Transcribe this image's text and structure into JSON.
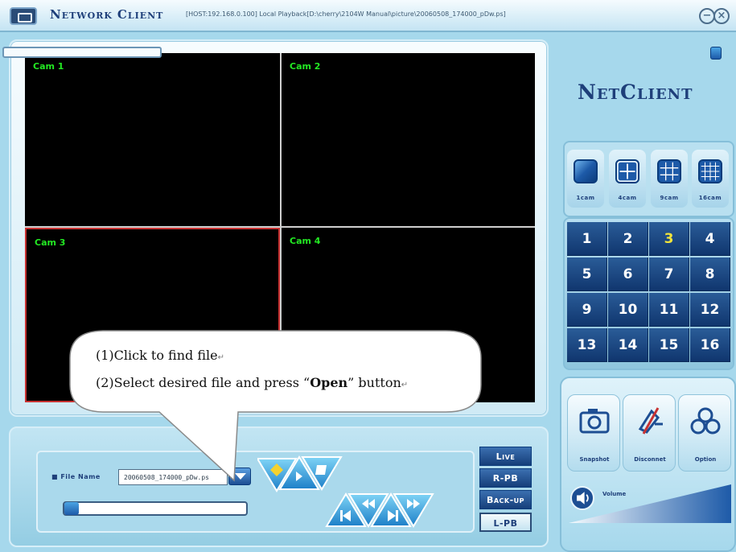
{
  "window": {
    "title_part1": "Network",
    "title_part2": "Client",
    "host_info": "[HOST:192.168.0.100] Local Playback[D:\\cherry\\2104W Manual\\picture\\20060508_174000_pDw.ps]",
    "minimize_label": "−",
    "close_label": "×"
  },
  "brand": {
    "part1": "Net",
    "part2": "Client"
  },
  "cameras": [
    {
      "label": "Cam  1"
    },
    {
      "label": "Cam  2"
    },
    {
      "label": "Cam  3"
    },
    {
      "label": "Cam  4"
    }
  ],
  "split_modes": [
    {
      "label": "1cam",
      "icon": "single-view-icon"
    },
    {
      "label": "4cam",
      "icon": "quad-view-icon"
    },
    {
      "label": "9cam",
      "icon": "nine-view-icon"
    },
    {
      "label": "16cam",
      "icon": "sixteen-view-icon"
    }
  ],
  "channels": [
    "1",
    "2",
    "3",
    "4",
    "5",
    "6",
    "7",
    "8",
    "9",
    "10",
    "11",
    "12",
    "13",
    "14",
    "15",
    "16"
  ],
  "active_channel": "3",
  "tools": {
    "snapshot": "Snapshot",
    "disconnect": "Disconnet",
    "option": "Option",
    "volume": "Volume"
  },
  "playback": {
    "file_name_label": "File Name",
    "file_name_value": "20060508_174000_pDw.ps",
    "progress": 0.0
  },
  "modes": {
    "live": "Live",
    "rpb": "R-PB",
    "backup": "Back-up",
    "lpb": "L-PB"
  },
  "volume_level": 0.95,
  "callout": {
    "line1": "(1)Click to find file",
    "line2_prefix": "(2)Select desired file and press “",
    "line2_bold": "Open",
    "line2_suffix": "” button",
    "return_mark": "↵"
  },
  "colors": {
    "cam_label": "#23e823",
    "selected_cam_border": "#c83232",
    "active_channel": "#f2e43a",
    "accent_blue": "#1d5aa8"
  }
}
